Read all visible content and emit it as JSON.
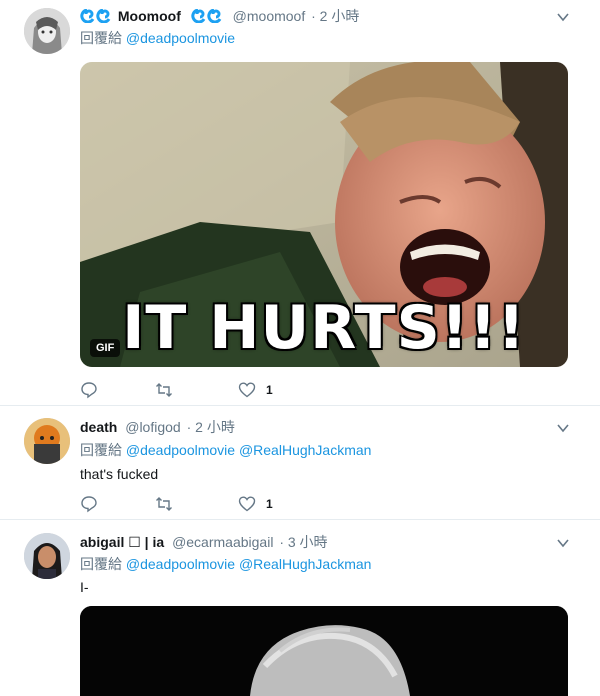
{
  "tweets": [
    {
      "display_name": "Moomoof",
      "handle": "@moomoof",
      "time": "· 2 小時",
      "reply_prefix": "回覆給",
      "mentions": [
        "@deadpoolmovie"
      ],
      "media": {
        "type": "gif",
        "badge": "GIF",
        "caption": "IT HURTS!!!"
      },
      "like_count": "1"
    },
    {
      "display_name": "death",
      "handle": "@lofigod",
      "time": "· 2 小時",
      "reply_prefix": "回覆給",
      "mentions": [
        "@deadpoolmovie",
        "@RealHughJackman"
      ],
      "text": "that's fucked",
      "like_count": "1"
    },
    {
      "display_name": "abigail ☐ | ia",
      "handle": "@ecarmaabigail",
      "time": "· 3 小時",
      "reply_prefix": "回覆給",
      "mentions": [
        "@deadpoolmovie",
        "@RealHughJackman"
      ],
      "text": "I-"
    }
  ],
  "icons": {
    "reply": "reply-icon",
    "retweet": "retweet-icon",
    "like": "heart-icon",
    "more": "chevron-down-icon",
    "badge": "wave-icon"
  },
  "colors": {
    "link": "#1b95e0",
    "muted": "#657786",
    "divider": "#e6ecf0",
    "wave": "#1da1f2"
  }
}
